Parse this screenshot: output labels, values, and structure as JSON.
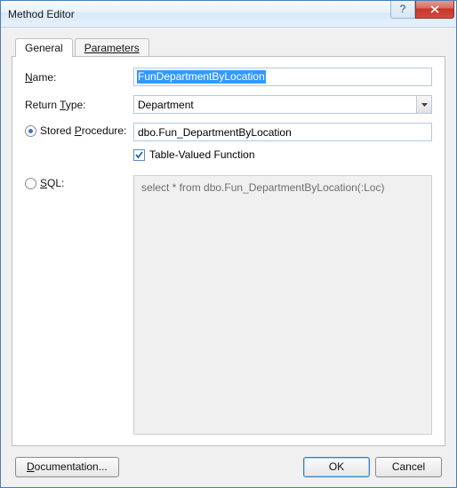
{
  "window": {
    "title": "Method Editor"
  },
  "tabs": {
    "general": "General",
    "parameters": "Parameters",
    "active": "general"
  },
  "form": {
    "name_label_pre": "",
    "name_label_u": "N",
    "name_label_post": "ame:",
    "name_value": "FunDepartmentByLocation",
    "return_label_pre": "Return ",
    "return_label_u": "T",
    "return_label_post": "ype:",
    "return_value": "Department",
    "sp_label_pre": "Stored ",
    "sp_label_u": "P",
    "sp_label_post": "rocedure:",
    "sp_value": "dbo.Fun_DepartmentByLocation",
    "tvf_label": "Table-Valued Function",
    "tvf_checked": true,
    "sp_selected": true,
    "sql_label_u": "S",
    "sql_label_post": "QL:",
    "sql_selected": false,
    "sql_text": "select * from dbo.Fun_DepartmentByLocation(:Loc)"
  },
  "buttons": {
    "documentation_u": "D",
    "documentation_post": "ocumentation...",
    "ok": "OK",
    "cancel": "Cancel"
  }
}
